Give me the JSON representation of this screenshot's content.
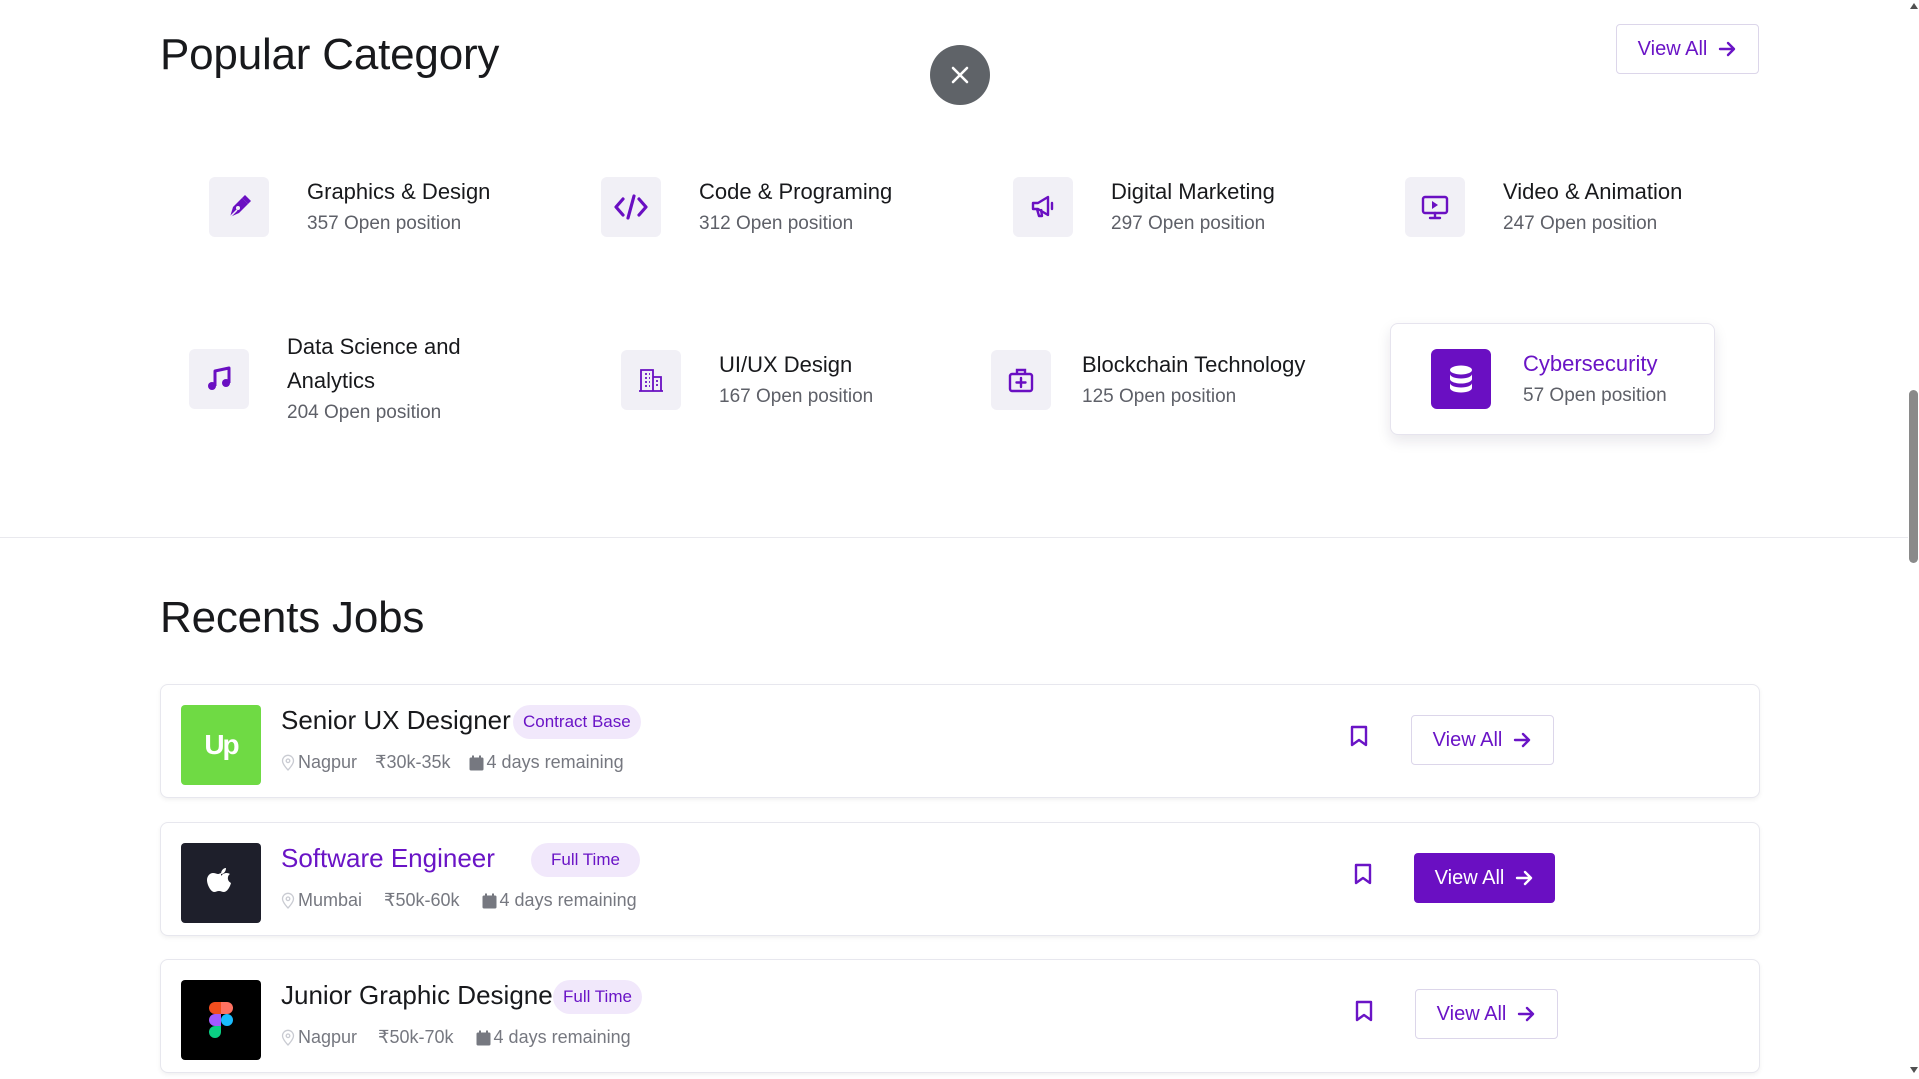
{
  "popular": {
    "title": "Popular Category",
    "view_all_label": "View All",
    "categories": [
      {
        "name": "Graphics & Design",
        "count": "357 Open position",
        "icon": "pen-tool-icon"
      },
      {
        "name": "Code & Programing",
        "count": "312 Open position",
        "icon": "code-icon"
      },
      {
        "name": "Digital Marketing",
        "count": "297 Open position",
        "icon": "megaphone-icon"
      },
      {
        "name": "Video & Animation",
        "count": "247 Open position",
        "icon": "monitor-play-icon"
      },
      {
        "name": "Data Science and Analytics",
        "count": "204 Open position",
        "icon": "music-note-icon"
      },
      {
        "name": "UI/UX Design",
        "count": "167 Open position",
        "icon": "building-icon"
      },
      {
        "name": "Blockchain Technology",
        "count": "125 Open position",
        "icon": "medical-kit-icon"
      },
      {
        "name": "Cybersecurity",
        "count": "57 Open position",
        "icon": "database-icon",
        "active": true
      }
    ]
  },
  "recent": {
    "title": "Recents Jobs",
    "jobs": [
      {
        "title": "Senior UX Designer",
        "badge": "Contract Base",
        "location": "Nagpur",
        "salary": "₹30k-35k",
        "remaining": "4 days remaining",
        "button": "View All",
        "logo": "upwork-logo"
      },
      {
        "title": "Software Engineer",
        "badge": "Full Time",
        "location": "Mumbai",
        "salary": "₹50k-60k",
        "remaining": "4 days remaining",
        "button": "View All",
        "logo": "apple-logo"
      },
      {
        "title": "Junior Graphic Designer",
        "badge": "Full Time",
        "location": "Nagpur",
        "salary": "₹50k-70k",
        "remaining": "4 days remaining",
        "button": "View All",
        "logo": "figma-logo"
      }
    ]
  },
  "logo_text": {
    "upwork": "Up"
  },
  "colors": {
    "accent": "#6a0fc2",
    "badge_bg": "#f1e8fb",
    "upwork_green": "#6fda44",
    "apple_bg": "#1e1f2b",
    "figma_bg": "#000000"
  }
}
